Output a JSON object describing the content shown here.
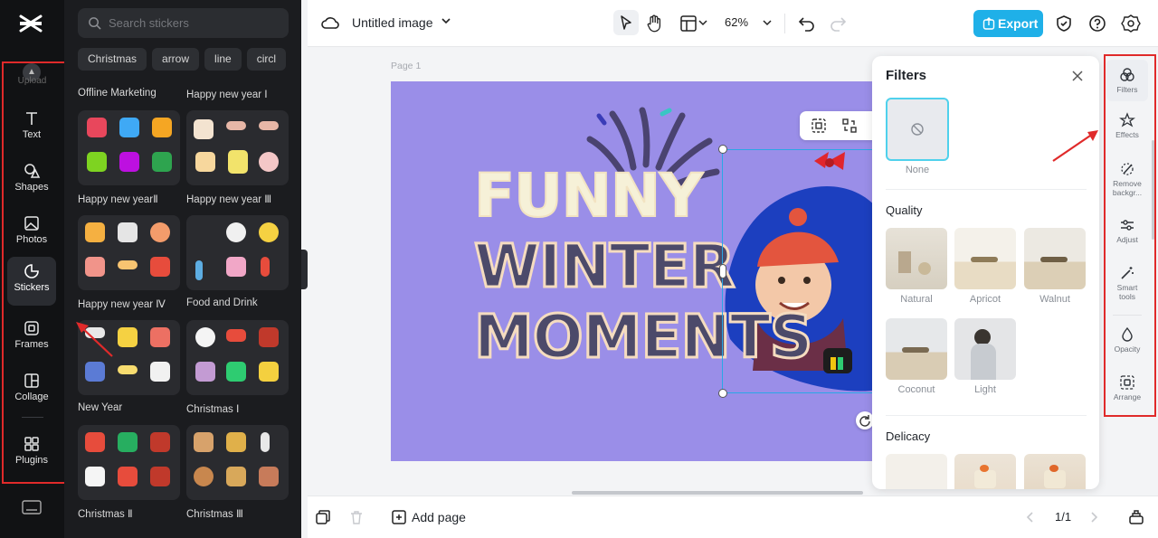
{
  "rail": {
    "upload_label": "Upload",
    "items": [
      {
        "label": "Text",
        "icon": "text-icon"
      },
      {
        "label": "Shapes",
        "icon": "shapes-icon"
      },
      {
        "label": "Photos",
        "icon": "photos-icon"
      },
      {
        "label": "Stickers",
        "icon": "stickers-icon",
        "active": true
      },
      {
        "label": "Frames",
        "icon": "frames-icon"
      },
      {
        "label": "Collage",
        "icon": "collage-icon"
      },
      {
        "label": "Plugins",
        "icon": "plugins-icon"
      }
    ]
  },
  "stickers": {
    "search_placeholder": "Search stickers",
    "chips": [
      "Christmas",
      "arrow",
      "line",
      "circl"
    ],
    "sections": [
      "Offline Marketing",
      "Happy new year Ⅰ",
      "Happy new yearⅡ",
      "Happy new year Ⅲ",
      "Happy new year Ⅳ",
      "Food and Drink",
      "New Year",
      "Christmas Ⅰ",
      "Christmas Ⅱ",
      "Christmas Ⅲ"
    ]
  },
  "topbar": {
    "title": "Untitled image",
    "zoom": "62%",
    "export_label": "Export"
  },
  "canvas": {
    "page_label": "Page 1",
    "headline": [
      "FUNNY",
      "WINTER",
      "MOMENTS"
    ]
  },
  "filters": {
    "title": "Filters",
    "none_label": "None",
    "quality_title": "Quality",
    "quality": [
      "Natural",
      "Apricot",
      "Walnut",
      "Coconut",
      "Light"
    ],
    "delicacy_title": "Delicacy"
  },
  "right_rail": [
    {
      "label": "Filters",
      "icon": "filters-icon",
      "active": true
    },
    {
      "label": "Effects",
      "icon": "effects-icon"
    },
    {
      "label": "Remove backgr...",
      "icon": "remove-background-icon"
    },
    {
      "label": "Adjust",
      "icon": "adjust-icon"
    },
    {
      "label": "Smart tools",
      "icon": "smart-tools-icon"
    },
    {
      "label": "Opacity",
      "icon": "opacity-icon"
    },
    {
      "label": "Arrange",
      "icon": "arrange-icon"
    }
  ],
  "bottombar": {
    "add_page_label": "Add page",
    "pager": "1/1"
  },
  "colors": {
    "accent": "#1fb0e8",
    "artboard": "#9a8ee8",
    "annotation": "#e02a2a"
  }
}
